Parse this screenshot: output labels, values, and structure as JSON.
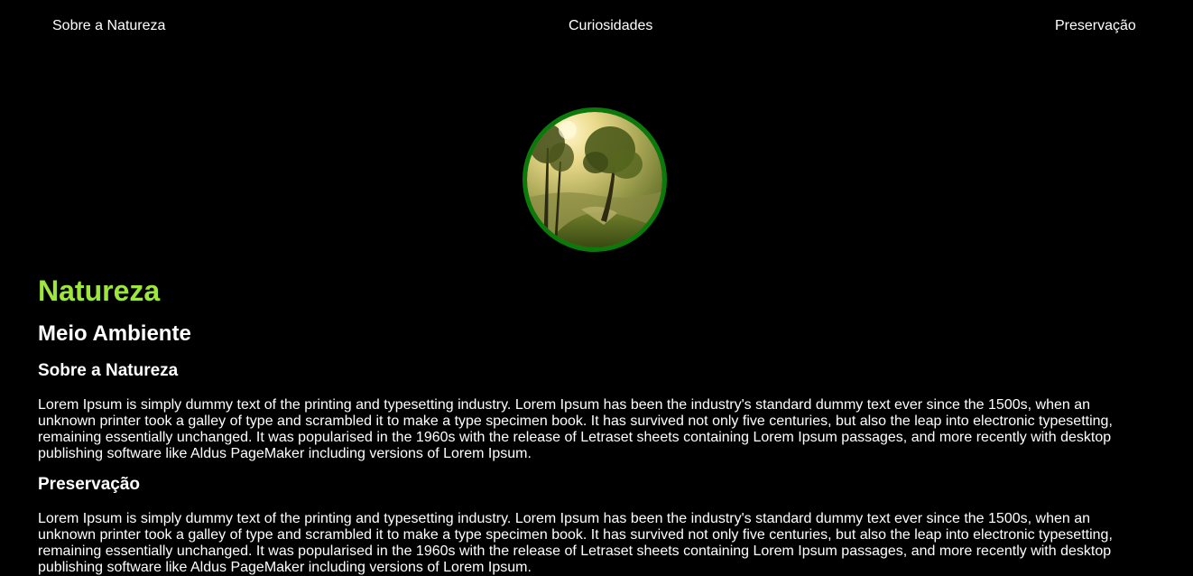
{
  "nav": {
    "items": [
      {
        "label": "Sobre a Natureza"
      },
      {
        "label": "Curiosidades"
      },
      {
        "label": "Preservação"
      }
    ]
  },
  "hero": {
    "icon": "nature-landscape-image",
    "border_color": "#0b7a0b"
  },
  "main": {
    "title": "Natureza",
    "title_color": "#9fe63c",
    "subtitle": "Meio Ambiente",
    "sections": [
      {
        "heading": "Sobre a Natureza",
        "body": "Lorem Ipsum is simply dummy text of the printing and typesetting industry. Lorem Ipsum has been the industry's standard dummy text ever since the 1500s, when an unknown printer took a galley of type and scrambled it to make a type specimen book. It has survived not only five centuries, but also the leap into electronic typesetting, remaining essentially unchanged. It was popularised in the 1960s with the release of Letraset sheets containing Lorem Ipsum passages, and more recently with desktop publishing software like Aldus PageMaker including versions of Lorem Ipsum."
      },
      {
        "heading": "Preservação",
        "body": "Lorem Ipsum is simply dummy text of the printing and typesetting industry. Lorem Ipsum has been the industry's standard dummy text ever since the 1500s, when an unknown printer took a galley of type and scrambled it to make a type specimen book. It has survived not only five centuries, but also the leap into electronic typesetting, remaining essentially unchanged. It was popularised in the 1960s with the release of Letraset sheets containing Lorem Ipsum passages, and more recently with desktop publishing software like Aldus PageMaker including versions of Lorem Ipsum."
      }
    ]
  }
}
